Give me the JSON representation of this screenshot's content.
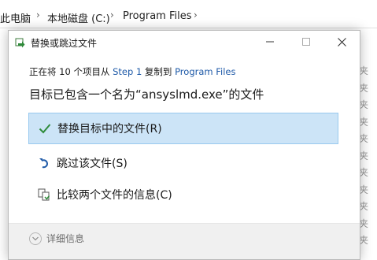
{
  "explorer": {
    "breadcrumb": [
      "此电脑",
      "本地磁盘 (C:)",
      "Program Files"
    ],
    "right_column_chars": [
      "夹",
      "夹",
      "夹",
      "夹",
      "夹",
      "夹",
      "夹",
      "夹",
      "夹",
      "夹",
      "夹"
    ]
  },
  "dialog": {
    "title": "替换或跳过文件",
    "status": {
      "prefix": "正在将 10 个项目从 ",
      "source": "Step 1",
      "middle": " 复制到 ",
      "destination": "Program Files"
    },
    "heading": "目标已包含一个名为“ansyslmd.exe”的文件",
    "options": {
      "replace": "替换目标中的文件(R)",
      "skip": "跳过该文件(S)",
      "compare": "比较两个文件的信息(C)"
    },
    "details_label": "详细信息"
  },
  "colors": {
    "selected_bg": "#cce4f7",
    "link": "#1f5aa8",
    "check": "#2e8b3a"
  }
}
